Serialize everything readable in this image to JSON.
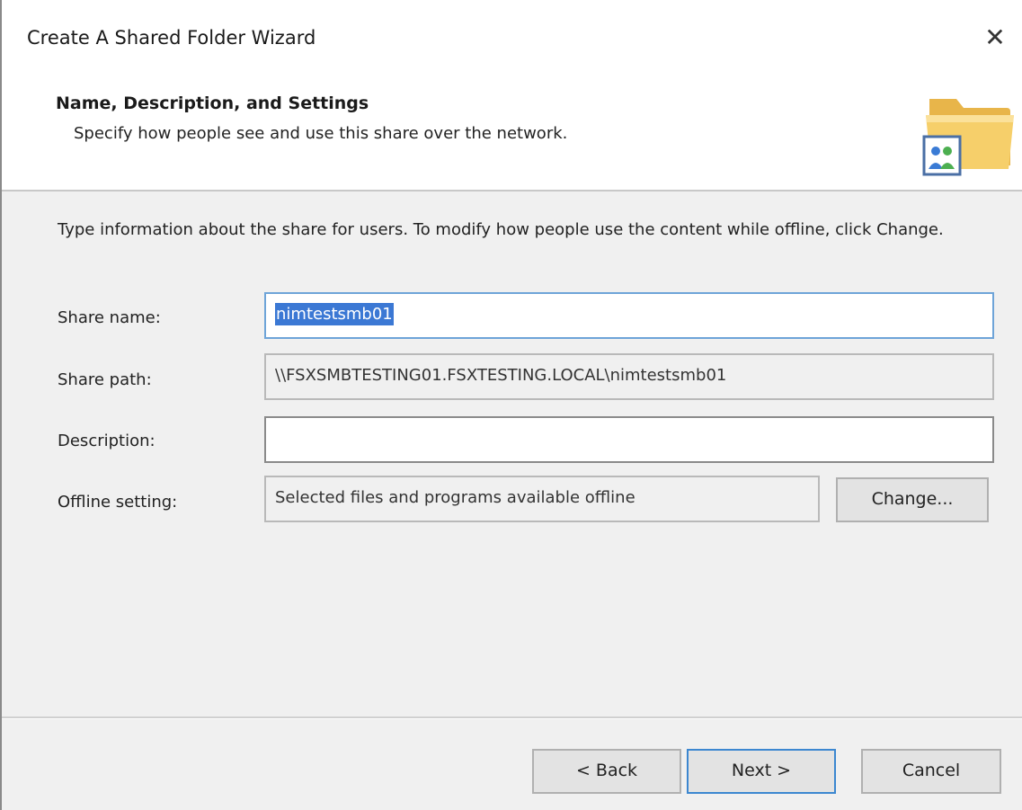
{
  "window": {
    "title": "Create A Shared Folder Wizard",
    "close_label": "✕"
  },
  "header": {
    "heading": "Name, Description, and Settings",
    "subheading": "Specify how people see and use this share over the network.",
    "icon": "shared-folder-icon"
  },
  "content": {
    "instructions": "Type information about the share for users. To modify how people use the content while offline, click Change.",
    "share_name": {
      "label": "Share name:",
      "value": "nimtestsmb01"
    },
    "share_path": {
      "label": "Share path:",
      "value": "\\\\FSXSMBTESTING01.FSXTESTING.LOCAL\\nimtestsmb01"
    },
    "description": {
      "label": "Description:",
      "value": ""
    },
    "offline_setting": {
      "label": "Offline setting:",
      "value": "Selected files and programs available offline",
      "change_label": "Change..."
    }
  },
  "footer": {
    "back_label": "< Back",
    "next_label": "Next >",
    "cancel_label": "Cancel"
  },
  "colors": {
    "selection": "#3b78d4",
    "default_button_border": "#3c87d0",
    "content_background": "#f0f0f0"
  }
}
